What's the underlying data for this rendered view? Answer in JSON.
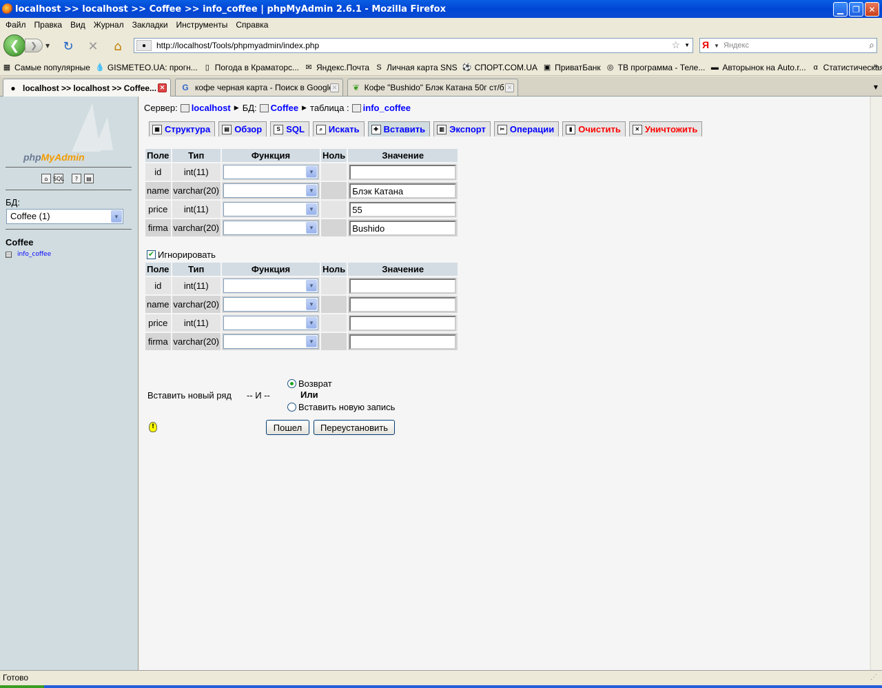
{
  "window": {
    "title": "localhost >> localhost >> Coffee  >> info_coffee | phpMyAdmin 2.6.1 - Mozilla Firefox"
  },
  "menu": [
    "Файл",
    "Правка",
    "Вид",
    "Журнал",
    "Закладки",
    "Инструменты",
    "Справка"
  ],
  "nav": {
    "url": "http://localhost/Tools/phpmyadmin/index.php",
    "search_placeholder": "Яндекс",
    "search_engine": "Я"
  },
  "bookmarks": [
    {
      "label": "Самые популярные",
      "icon": "bookmark-folder-icon"
    },
    {
      "label": "GISMETEO.UA: прогн...",
      "icon": "drop-icon"
    },
    {
      "label": "Погода в Краматорс...",
      "icon": "page-icon"
    },
    {
      "label": "Яндекс.Почта",
      "icon": "mail-icon"
    },
    {
      "label": "Личная карта SNS",
      "icon": "s-icon"
    },
    {
      "label": "СПОРТ.COM.UA",
      "icon": "ball-icon"
    },
    {
      "label": "ПриватБанк",
      "icon": "bank-icon"
    },
    {
      "label": "ТВ программа - Теле...",
      "icon": "tv-icon"
    },
    {
      "label": "Авторынок на Auto.r...",
      "icon": "car-icon"
    },
    {
      "label": "Статистическая пом...",
      "icon": "alpha-icon"
    }
  ],
  "tabs": [
    {
      "label": "localhost >> localhost >> Coffee...",
      "active": true
    },
    {
      "label": "кофе черная карта - Поиск в Google",
      "active": false
    },
    {
      "label": "Кофе \"Bushido\" Блэк Катана 50г ст/б ...",
      "active": false
    }
  ],
  "sidebar": {
    "logo_text_php": "php",
    "logo_text_admin": "MyAdmin",
    "db_label": "БД:",
    "db_selected": "Coffee (1)",
    "db_name": "Coffee",
    "tables": [
      "info_coffee"
    ]
  },
  "breadcrumb": {
    "server_label": "Сервер:",
    "server": "localhost",
    "db_label": "БД:",
    "db": "Coffee",
    "table_label": "таблица :",
    "table": "info_coffee"
  },
  "pma_tabs": [
    {
      "label": "Структура",
      "icon": "structure-icon",
      "color": "#0000ff"
    },
    {
      "label": "Обзор",
      "icon": "browse-icon",
      "color": "#0000ff"
    },
    {
      "label": "SQL",
      "icon": "sql-icon",
      "color": "#0000ff"
    },
    {
      "label": "Искать",
      "icon": "search-icon",
      "color": "#0000ff"
    },
    {
      "label": "Вставить",
      "icon": "insert-icon",
      "color": "#0000ff",
      "active": true
    },
    {
      "label": "Экспорт",
      "icon": "export-icon",
      "color": "#0000ff"
    },
    {
      "label": "Операции",
      "icon": "tools-icon",
      "color": "#0000ff"
    },
    {
      "label": "Очистить",
      "icon": "trash-icon",
      "color": "#ff0000"
    },
    {
      "label": "Уничтожить",
      "icon": "drop-table-icon",
      "color": "#ff0000"
    }
  ],
  "form": {
    "headers": [
      "Поле",
      "Тип",
      "Функция",
      "Ноль",
      "Значение"
    ],
    "block1": [
      {
        "field": "id",
        "type": "int(11)",
        "value": ""
      },
      {
        "field": "name",
        "type": "varchar(20)",
        "value": "Блэк Катана"
      },
      {
        "field": "price",
        "type": "int(11)",
        "value": "55"
      },
      {
        "field": "firma",
        "type": "varchar(20)",
        "value": "Bushido"
      }
    ],
    "ignore_label": "Игнорировать",
    "block2": [
      {
        "field": "id",
        "type": "int(11)",
        "value": ""
      },
      {
        "field": "name",
        "type": "varchar(20)",
        "value": ""
      },
      {
        "field": "price",
        "type": "int(11)",
        "value": ""
      },
      {
        "field": "firma",
        "type": "varchar(20)",
        "value": ""
      }
    ],
    "insert_new_row": "Вставить новый ряд",
    "and_text": "-- И --",
    "radio_return": "Возврат",
    "or_text": "Или",
    "radio_insert_another": "Вставить новую запись",
    "go_button": "Пошел",
    "reset_button": "Переустановить"
  },
  "status": "Готово"
}
